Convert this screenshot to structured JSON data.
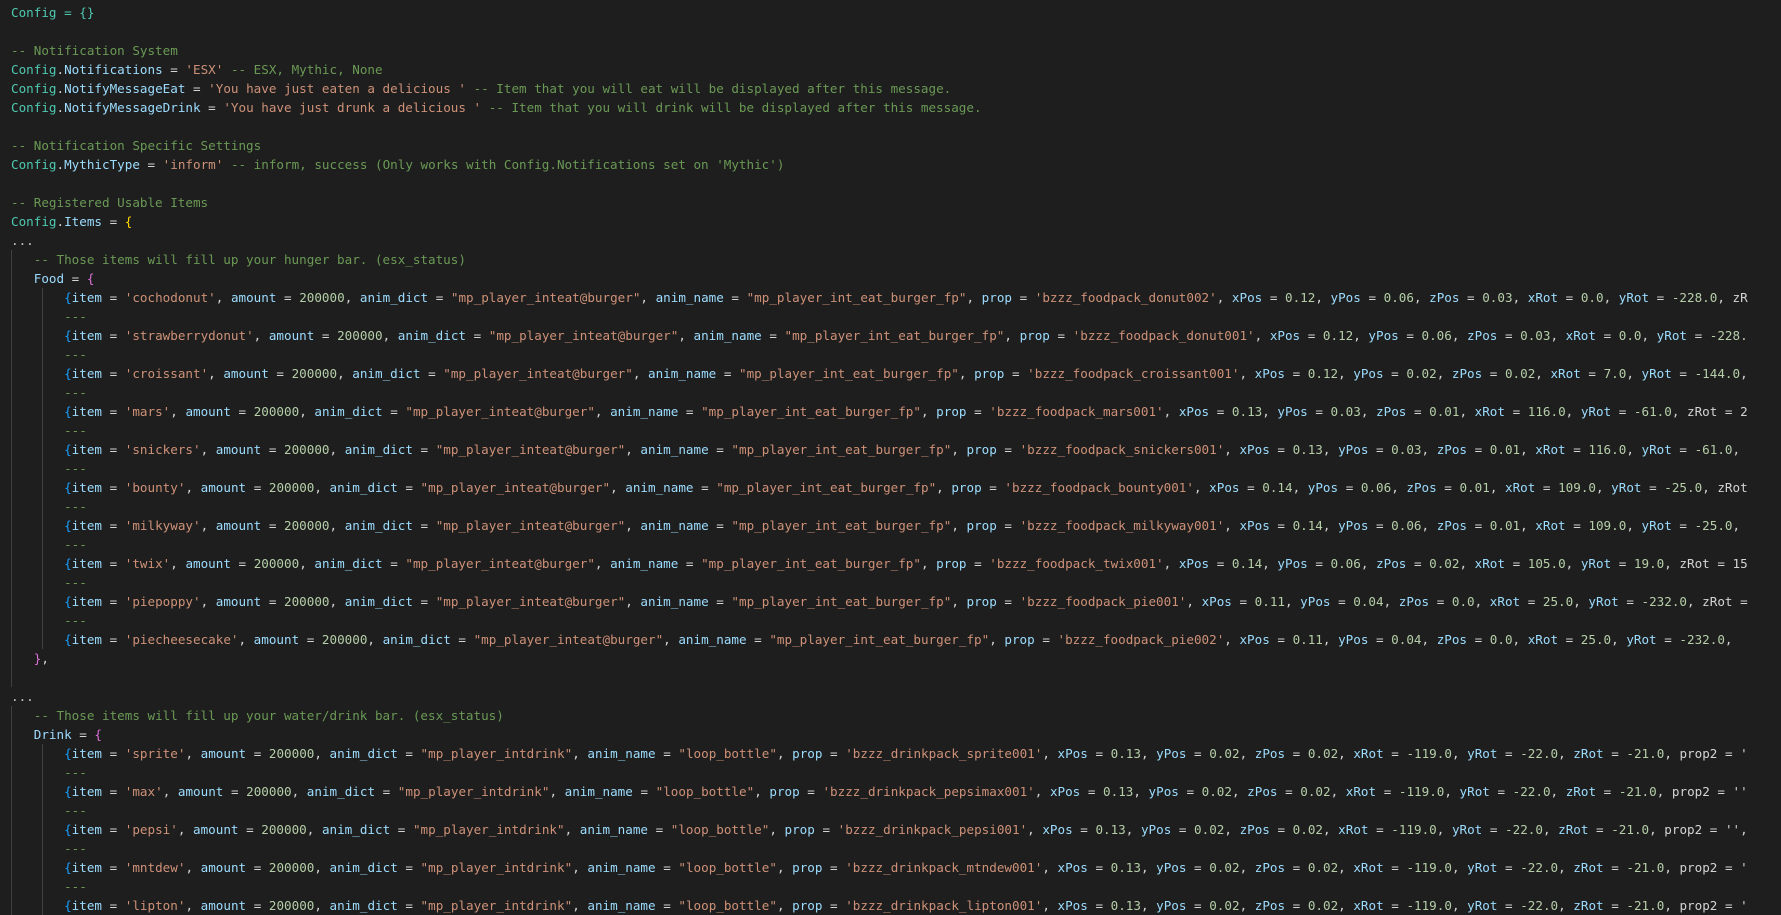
{
  "editor": {
    "theme_colors": {
      "background": "#1e1e1e",
      "comment": "#6a9955",
      "string": "#ce9178",
      "number": "#b5cea8",
      "property": "#9cdcfe",
      "identifier": "#4ec9b0"
    },
    "header": {
      "config_init": "Config = {}",
      "comment_notify": "-- Notification System",
      "notifications_key": "Notifications",
      "notifications_value": "'ESX'",
      "notifications_comment": "-- ESX, Mythic, None",
      "eat_key": "NotifyMessageEat",
      "eat_value": "'You have just eaten a delicious '",
      "eat_comment": "-- Item that you will eat will be displayed after this message.",
      "drink_key": "NotifyMessageDrink",
      "drink_value": "'You have just drunk a delicious '",
      "drink_comment": "-- Item that you will drink will be displayed after this message.",
      "comment_specific": "-- Notification Specific Settings",
      "mythic_key": "MythicType",
      "mythic_value": "'inform'",
      "mythic_comment": "-- inform, success (Only works with Config.Notifications set on 'Mythic')",
      "comment_registered": "-- Registered Usable Items",
      "items_key": "Items"
    },
    "food": {
      "comment": "-- Those items will fill up your hunger bar. (esx_status)",
      "label": "Food",
      "rows": [
        {
          "item": "'cochodonut'",
          "amount": "200000",
          "anim_dict": "\"mp_player_inteat@burger\"",
          "anim_name": "\"mp_player_int_eat_burger_fp\"",
          "prop": "'bzzz_foodpack_donut002'",
          "xPos": "0.12",
          "yPos": "0.06",
          "zPos": "0.03",
          "xRot": "0.0",
          "yRot": "-228.0",
          "tail": ", zR"
        },
        {
          "item": "'strawberrydonut'",
          "amount": "200000",
          "anim_dict": "\"mp_player_inteat@burger\"",
          "anim_name": "\"mp_player_int_eat_burger_fp\"",
          "prop": "'bzzz_foodpack_donut001'",
          "xPos": "0.12",
          "yPos": "0.06",
          "zPos": "0.03",
          "xRot": "0.0",
          "yRot": "-228.",
          "tail": ""
        },
        {
          "item": "'croissant'",
          "amount": "200000",
          "anim_dict": "\"mp_player_inteat@burger\"",
          "anim_name": "\"mp_player_int_eat_burger_fp\"",
          "prop": "'bzzz_foodpack_croissant001'",
          "xPos": "0.12",
          "yPos": "0.02",
          "zPos": "0.02",
          "xRot": "7.0",
          "yRot": "-144.0",
          "tail": ","
        },
        {
          "item": "'mars'",
          "amount": "200000",
          "anim_dict": "\"mp_player_inteat@burger\"",
          "anim_name": "\"mp_player_int_eat_burger_fp\"",
          "prop": "'bzzz_foodpack_mars001'",
          "xPos": "0.13",
          "yPos": "0.03",
          "zPos": "0.01",
          "xRot": "116.0",
          "yRot": "-61.0",
          "tail": ", zRot = 2"
        },
        {
          "item": "'snickers'",
          "amount": "200000",
          "anim_dict": "\"mp_player_inteat@burger\"",
          "anim_name": "\"mp_player_int_eat_burger_fp\"",
          "prop": "'bzzz_foodpack_snickers001'",
          "xPos": "0.13",
          "yPos": "0.03",
          "zPos": "0.01",
          "xRot": "116.0",
          "yRot": "-61.0",
          "tail": ","
        },
        {
          "item": "'bounty'",
          "amount": "200000",
          "anim_dict": "\"mp_player_inteat@burger\"",
          "anim_name": "\"mp_player_int_eat_burger_fp\"",
          "prop": "'bzzz_foodpack_bounty001'",
          "xPos": "0.14",
          "yPos": "0.06",
          "zPos": "0.01",
          "xRot": "109.0",
          "yRot": "-25.0",
          "tail": ", zRot"
        },
        {
          "item": "'milkyway'",
          "amount": "200000",
          "anim_dict": "\"mp_player_inteat@burger\"",
          "anim_name": "\"mp_player_int_eat_burger_fp\"",
          "prop": "'bzzz_foodpack_milkyway001'",
          "xPos": "0.14",
          "yPos": "0.06",
          "zPos": "0.01",
          "xRot": "109.0",
          "yRot": "-25.0",
          "tail": ","
        },
        {
          "item": "'twix'",
          "amount": "200000",
          "anim_dict": "\"mp_player_inteat@burger\"",
          "anim_name": "\"mp_player_int_eat_burger_fp\"",
          "prop": "'bzzz_foodpack_twix001'",
          "xPos": "0.14",
          "yPos": "0.06",
          "zPos": "0.02",
          "xRot": "105.0",
          "yRot": "19.0",
          "tail": ", zRot = 15"
        },
        {
          "item": "'piepoppy'",
          "amount": "200000",
          "anim_dict": "\"mp_player_inteat@burger\"",
          "anim_name": "\"mp_player_int_eat_burger_fp\"",
          "prop": "'bzzz_foodpack_pie001'",
          "xPos": "0.11",
          "yPos": "0.04",
          "zPos": "0.0",
          "xRot": "25.0",
          "yRot": "-232.0",
          "tail": ", zRot ="
        },
        {
          "item": "'piecheesecake'",
          "amount": "200000",
          "anim_dict": "\"mp_player_inteat@burger\"",
          "anim_name": "\"mp_player_int_eat_burger_fp\"",
          "prop": "'bzzz_foodpack_pie002'",
          "xPos": "0.11",
          "yPos": "0.04",
          "zPos": "0.0",
          "xRot": "25.0",
          "yRot": "-232.0",
          "tail": ","
        }
      ]
    },
    "drink": {
      "comment": "-- Those items will fill up your water/drink bar. (esx_status)",
      "label": "Drink",
      "rows": [
        {
          "item": "'sprite'",
          "amount": "200000",
          "anim_dict": "\"mp_player_intdrink\"",
          "anim_name": "\"loop_bottle\"",
          "prop": "'bzzz_drinkpack_sprite001'",
          "xPos": "0.13",
          "yPos": "0.02",
          "zPos": "0.02",
          "xRot": "-119.0",
          "yRot": "-22.0",
          "zRot": "-21.0",
          "tail": ", prop2 = '"
        },
        {
          "item": "'max'",
          "amount": "200000",
          "anim_dict": "\"mp_player_intdrink\"",
          "anim_name": "\"loop_bottle\"",
          "prop": "'bzzz_drinkpack_pepsimax001'",
          "xPos": "0.13",
          "yPos": "0.02",
          "zPos": "0.02",
          "xRot": "-119.0",
          "yRot": "-22.0",
          "zRot": "-21.0",
          "tail": ", prop2 = ''"
        },
        {
          "item": "'pepsi'",
          "amount": "200000",
          "anim_dict": "\"mp_player_intdrink\"",
          "anim_name": "\"loop_bottle\"",
          "prop": "'bzzz_drinkpack_pepsi001'",
          "xPos": "0.13",
          "yPos": "0.02",
          "zPos": "0.02",
          "xRot": "-119.0",
          "yRot": "-22.0",
          "zRot": "-21.0",
          "tail": ", prop2 = '',"
        },
        {
          "item": "'mntdew'",
          "amount": "200000",
          "anim_dict": "\"mp_player_intdrink\"",
          "anim_name": "\"loop_bottle\"",
          "prop": "'bzzz_drinkpack_mtndew001'",
          "xPos": "0.13",
          "yPos": "0.02",
          "zPos": "0.02",
          "xRot": "-119.0",
          "yRot": "-22.0",
          "zRot": "-21.0",
          "tail": ", prop2 = '"
        },
        {
          "item": "'lipton'",
          "amount": "200000",
          "anim_dict": "\"mp_player_intdrink\"",
          "anim_name": "\"loop_bottle\"",
          "prop": "'bzzz_drinkpack_lipton001'",
          "xPos": "0.13",
          "yPos": "0.02",
          "zPos": "0.02",
          "xRot": "-119.0",
          "yRot": "-22.0",
          "zRot": "-21.0",
          "tail": ", prop2 = '"
        }
      ]
    },
    "fold_marker": "...",
    "row_separator": "---",
    "food_close": "},"
  }
}
